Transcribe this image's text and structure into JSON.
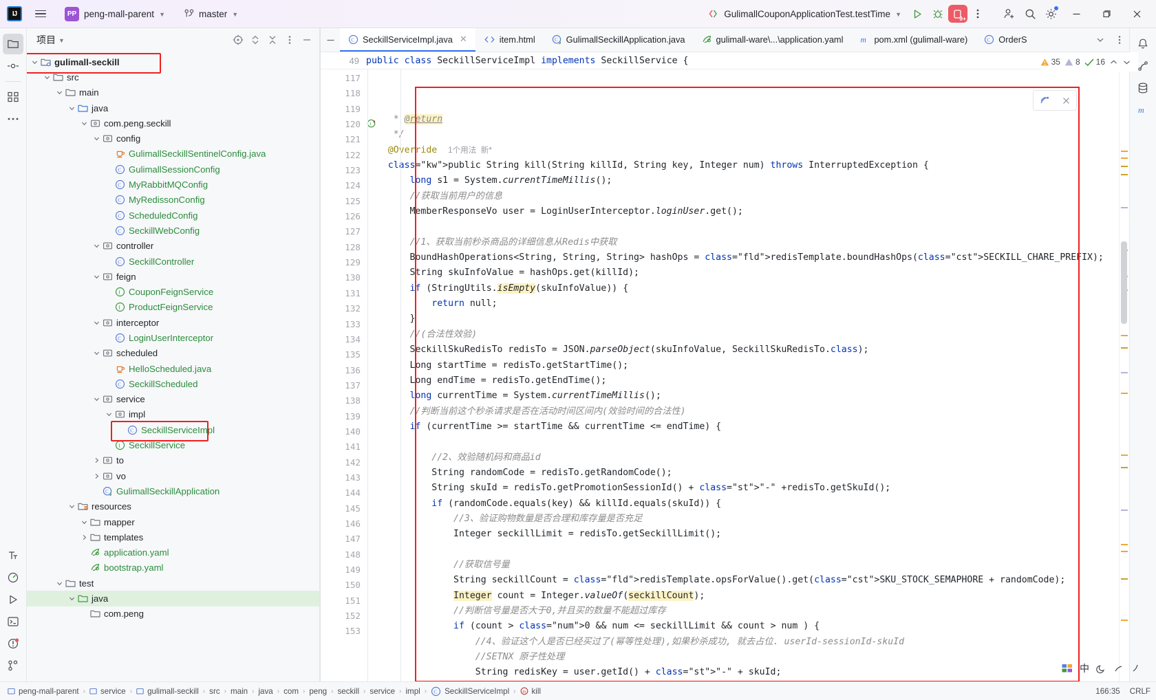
{
  "titlebar": {
    "logo": "IJ",
    "project_name": "peng-mall-parent",
    "project_badge": "PP",
    "branch": "master",
    "run_config": "GulimallCouponApplicationTest.testTime",
    "debug_count": "9+",
    "icons": {
      "menu": "hamburger-menu-icon",
      "vcs": "branch-icon",
      "run": "run-icon",
      "debug": "debug-icon",
      "more": "more-vertical-icon",
      "share": "add-user-icon",
      "search": "search-icon",
      "settings": "gear-icon",
      "minimize": "minimize-icon",
      "maximize": "maximize-icon",
      "close": "close-icon"
    }
  },
  "project_panel": {
    "title": "项目",
    "tools": [
      "select-opened-file-icon",
      "expand-collapse-icon",
      "collapse-all-icon",
      "options-icon",
      "hide-icon"
    ],
    "tree": [
      {
        "label": "gulimall-seckill",
        "depth": 0,
        "arrow": "down",
        "icon": "module-folder",
        "style": "bold",
        "boxed": true
      },
      {
        "label": "src",
        "depth": 1,
        "arrow": "down",
        "icon": "folder"
      },
      {
        "label": "main",
        "depth": 2,
        "arrow": "down",
        "icon": "folder"
      },
      {
        "label": "java",
        "depth": 3,
        "arrow": "down",
        "icon": "source-folder"
      },
      {
        "label": "com.peng.seckill",
        "depth": 4,
        "arrow": "down",
        "icon": "package"
      },
      {
        "label": "config",
        "depth": 5,
        "arrow": "down",
        "icon": "package"
      },
      {
        "label": "GulimallSeckillSentinelConfig.java",
        "depth": 6,
        "arrow": "none",
        "icon": "java-file",
        "style": "green"
      },
      {
        "label": "GulimallSessionConfig",
        "depth": 6,
        "arrow": "none",
        "icon": "class",
        "style": "green"
      },
      {
        "label": "MyRabbitMQConfig",
        "depth": 6,
        "arrow": "none",
        "icon": "class",
        "style": "green"
      },
      {
        "label": "MyRedissonConfig",
        "depth": 6,
        "arrow": "none",
        "icon": "class",
        "style": "green"
      },
      {
        "label": "ScheduledConfig",
        "depth": 6,
        "arrow": "none",
        "icon": "class",
        "style": "green"
      },
      {
        "label": "SeckillWebConfig",
        "depth": 6,
        "arrow": "none",
        "icon": "class",
        "style": "green"
      },
      {
        "label": "controller",
        "depth": 5,
        "arrow": "down",
        "icon": "package"
      },
      {
        "label": "SeckillController",
        "depth": 6,
        "arrow": "none",
        "icon": "class",
        "style": "green"
      },
      {
        "label": "feign",
        "depth": 5,
        "arrow": "down",
        "icon": "package"
      },
      {
        "label": "CouponFeignService",
        "depth": 6,
        "arrow": "none",
        "icon": "interface",
        "style": "green"
      },
      {
        "label": "ProductFeignService",
        "depth": 6,
        "arrow": "none",
        "icon": "interface",
        "style": "green"
      },
      {
        "label": "interceptor",
        "depth": 5,
        "arrow": "down",
        "icon": "package"
      },
      {
        "label": "LoginUserInterceptor",
        "depth": 6,
        "arrow": "none",
        "icon": "class",
        "style": "green"
      },
      {
        "label": "scheduled",
        "depth": 5,
        "arrow": "down",
        "icon": "package"
      },
      {
        "label": "HelloScheduled.java",
        "depth": 6,
        "arrow": "none",
        "icon": "java-file",
        "style": "green"
      },
      {
        "label": "SeckillScheduled",
        "depth": 6,
        "arrow": "none",
        "icon": "class",
        "style": "green"
      },
      {
        "label": "service",
        "depth": 5,
        "arrow": "down",
        "icon": "package"
      },
      {
        "label": "impl",
        "depth": 6,
        "arrow": "down",
        "icon": "package"
      },
      {
        "label": "SeckillServiceImpl",
        "depth": 7,
        "arrow": "none",
        "icon": "class",
        "style": "green",
        "boxed": true
      },
      {
        "label": "SeckillService",
        "depth": 6,
        "arrow": "none",
        "icon": "interface",
        "style": "green"
      },
      {
        "label": "to",
        "depth": 5,
        "arrow": "right",
        "icon": "package"
      },
      {
        "label": "vo",
        "depth": 5,
        "arrow": "right",
        "icon": "package"
      },
      {
        "label": "GulimallSeckillApplication",
        "depth": 5,
        "arrow": "none",
        "icon": "spring-class",
        "style": "green"
      },
      {
        "label": "resources",
        "depth": 3,
        "arrow": "down",
        "icon": "resources-folder"
      },
      {
        "label": "mapper",
        "depth": 4,
        "arrow": "down",
        "icon": "folder"
      },
      {
        "label": "templates",
        "depth": 4,
        "arrow": "right",
        "icon": "folder"
      },
      {
        "label": "application.yaml",
        "depth": 4,
        "arrow": "none",
        "icon": "yaml-file",
        "style": "green"
      },
      {
        "label": "bootstrap.yaml",
        "depth": 4,
        "arrow": "none",
        "icon": "yaml-file",
        "style": "green"
      },
      {
        "label": "test",
        "depth": 2,
        "arrow": "down",
        "icon": "folder"
      },
      {
        "label": "java",
        "depth": 3,
        "arrow": "down",
        "icon": "test-source-folder",
        "highlighted": true
      },
      {
        "label": "com.peng",
        "depth": 4,
        "arrow": "none",
        "icon": "folder"
      }
    ]
  },
  "editor": {
    "tabs": [
      {
        "label": "SeckillServiceImpl.java",
        "icon": "class",
        "active": true,
        "closable": true
      },
      {
        "label": "item.html",
        "icon": "html-file",
        "active": false
      },
      {
        "label": "GulimallSeckillApplication.java",
        "icon": "spring-class",
        "active": false
      },
      {
        "label": "gulimall-ware\\...\\application.yaml",
        "icon": "yaml-file",
        "active": false
      },
      {
        "label": "pom.xml (gulimall-ware)",
        "icon": "maven-file",
        "active": false
      },
      {
        "label": "OrderS",
        "icon": "class",
        "active": false
      }
    ],
    "tab_overflow_icons": [
      "chevron-down-icon",
      "more-vertical-icon"
    ],
    "sticky_header": {
      "line": "49",
      "code": "public class SeckillServiceImpl implements SeckillService {"
    },
    "inspections": {
      "warnings": "35",
      "weak_warnings": "8",
      "typos": "16"
    },
    "lines": [
      {
        "n": "117",
        "code": "     * @return"
      },
      {
        "n": "118",
        "code": "     */"
      },
      {
        "n": "119",
        "code": "    @Override  1个用法  新*"
      },
      {
        "n": "120",
        "code": "    public String kill(String killId, String key, Integer num) throws InterruptedException {",
        "marker": "override-implement"
      },
      {
        "n": "121",
        "code": "        long s1 = System.currentTimeMillis();"
      },
      {
        "n": "122",
        "code": "        //获取当前用户的信息"
      },
      {
        "n": "123",
        "code": "        MemberResponseVo user = LoginUserInterceptor.loginUser.get();"
      },
      {
        "n": "124",
        "code": ""
      },
      {
        "n": "125",
        "code": "        //1、获取当前秒杀商品的详细信息从Redis中获取"
      },
      {
        "n": "126",
        "code": "        BoundHashOperations<String, String, String> hashOps = redisTemplate.boundHashOps(SECKILL_CHARE_PREFIX);"
      },
      {
        "n": "127",
        "code": "        String skuInfoValue = hashOps.get(killId);"
      },
      {
        "n": "128",
        "code": "        if (StringUtils.isEmpty(skuInfoValue)) {"
      },
      {
        "n": "129",
        "code": "            return null;"
      },
      {
        "n": "130",
        "code": "        }"
      },
      {
        "n": "131",
        "code": "        //(合法性效验)"
      },
      {
        "n": "132",
        "code": "        SeckillSkuRedisTo redisTo = JSON.parseObject(skuInfoValue, SeckillSkuRedisTo.class);"
      },
      {
        "n": "133",
        "code": "        Long startTime = redisTo.getStartTime();"
      },
      {
        "n": "134",
        "code": "        Long endTime = redisTo.getEndTime();"
      },
      {
        "n": "135",
        "code": "        long currentTime = System.currentTimeMillis();"
      },
      {
        "n": "136",
        "code": "        //判断当前这个秒杀请求是否在活动时间区间内(效验时间的合法性)"
      },
      {
        "n": "137",
        "code": "        if (currentTime >= startTime && currentTime <= endTime) {"
      },
      {
        "n": "138",
        "code": ""
      },
      {
        "n": "139",
        "code": "            //2、效验随机码和商品id"
      },
      {
        "n": "140",
        "code": "            String randomCode = redisTo.getRandomCode();"
      },
      {
        "n": "141",
        "code": "            String skuId = redisTo.getPromotionSessionId() + \"-\" +redisTo.getSkuId();"
      },
      {
        "n": "142",
        "code": "            if (randomCode.equals(key) && killId.equals(skuId)) {"
      },
      {
        "n": "143",
        "code": "                //3、验证购物数量是否合理和库存量是否充足"
      },
      {
        "n": "144",
        "code": "                Integer seckillLimit = redisTo.getSeckillLimit();"
      },
      {
        "n": "145",
        "code": ""
      },
      {
        "n": "146",
        "code": "                //获取信号量"
      },
      {
        "n": "147",
        "code": "                String seckillCount = redisTemplate.opsForValue().get(SKU_STOCK_SEMAPHORE + randomCode);"
      },
      {
        "n": "148",
        "code": "                Integer count = Integer.valueOf(seckillCount);"
      },
      {
        "n": "149",
        "code": "                //判断信号量是否大于0,并且买的数量不能超过库存"
      },
      {
        "n": "150",
        "code": "                if (count > 0 && num <= seckillLimit && count > num ) {"
      },
      {
        "n": "151",
        "code": "                    //4、验证这个人是否已经买过了(幂等性处理),如果秒杀成功, 就去占位. userId-sessionId-skuId"
      },
      {
        "n": "152",
        "code": "                    //SETNX 原子性处理"
      },
      {
        "n": "153",
        "code": "                    String redisKey = user.getId() + \"-\" + skuId;"
      }
    ]
  },
  "status_bar": {
    "breadcrumbs": [
      {
        "label": "peng-mall-parent",
        "icon": "module"
      },
      {
        "label": "service",
        "icon": "module"
      },
      {
        "label": "gulimall-seckill",
        "icon": "module"
      },
      {
        "label": "src",
        "icon": "none"
      },
      {
        "label": "main",
        "icon": "none"
      },
      {
        "label": "java",
        "icon": "none"
      },
      {
        "label": "com",
        "icon": "none"
      },
      {
        "label": "peng",
        "icon": "none"
      },
      {
        "label": "seckill",
        "icon": "none"
      },
      {
        "label": "service",
        "icon": "none"
      },
      {
        "label": "impl",
        "icon": "none"
      },
      {
        "label": "SeckillServiceImpl",
        "icon": "class"
      },
      {
        "label": "kill",
        "icon": "method"
      }
    ],
    "caret_position": "166:35",
    "line_separator": "CRLF"
  },
  "right_rail_icons": [
    "notifications-icon",
    "ai-assistant-icon",
    "database-icon",
    "maven-icon"
  ],
  "left_rail_icons": [
    "project-icon",
    "commit-icon",
    "structure-icon",
    "more-icon"
  ],
  "left_rail_bottom_icons": [
    "terminal-font-icon",
    "profiler-icon",
    "run-icon",
    "terminal-icon",
    "problems-icon",
    "vcs-icon"
  ],
  "ime_indicator": {
    "lang": "中",
    "icons": [
      "moon-icon",
      "sun-icon",
      "bell-icon"
    ]
  },
  "colors": {
    "accent": "#3574f0",
    "highlight_box": "#f01f1f",
    "green_file": "#2c8c3c",
    "keyword": "#0033b3",
    "string": "#067d17",
    "comment": "#8c8c8c",
    "constant": "#871094",
    "selection_highlight": "#fcf2c4",
    "tree_highlight": "#dff0df"
  }
}
